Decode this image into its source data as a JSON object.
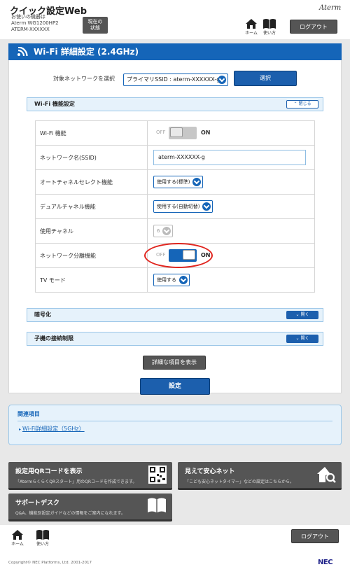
{
  "header": {
    "app_title": "クイック設定Web",
    "device_line1": "お使いの機器は",
    "device_line2": "Aterm WG1200HP2",
    "device_line3": "ATERM-XXXXXX",
    "status_button_line1": "現在の",
    "status_button_line2": "状態",
    "brand": "Aterm",
    "home_label": "ホーム",
    "help_label": "使い方",
    "logout_label": "ログアウト"
  },
  "page": {
    "title": "Wi-Fi 詳細設定 (2.4GHz)",
    "target_network_label": "対象ネットワークを選択",
    "target_network_value": "プライマリSSID : aterm-XXXXXX-g",
    "select_button": "選択"
  },
  "wifi_section": {
    "title": "Wi-Fi 機能設定",
    "collapse_label": "閉じる",
    "rows": [
      {
        "label": "Wi-Fi 機能",
        "type": "switch",
        "off": "OFF",
        "on": "ON",
        "state": "off"
      },
      {
        "label": "ネットワーク名(SSID)",
        "type": "text",
        "value": "aterm-XXXXXX-g"
      },
      {
        "label": "オートチャネルセレクト機能",
        "type": "select",
        "value": "使用する(標準)"
      },
      {
        "label": "デュアルチャネル機能",
        "type": "select",
        "value": "使用する(自動切替)"
      },
      {
        "label": "使用チャネル",
        "type": "select-disabled",
        "value": "6"
      },
      {
        "label": "ネットワーク分離機能",
        "type": "switch",
        "off": "OFF",
        "on": "ON",
        "state": "on"
      },
      {
        "label": "TV モード",
        "type": "select",
        "value": "使用する"
      }
    ]
  },
  "collapsed_sections": [
    {
      "title": "暗号化",
      "expand_label": "開く"
    },
    {
      "title": "子機の接続制限",
      "expand_label": "開く"
    }
  ],
  "actions": {
    "show_details": "詳細な項目を表示",
    "apply": "設定"
  },
  "related": {
    "title": "関連項目",
    "link": "Wi-Fi詳細設定（5GHz）"
  },
  "tiles": [
    {
      "title": "設定用QRコードを表示",
      "desc": "「AtermらくらくQRスタート」用のQRコードを作成できます。",
      "icon": "qr-code-icon"
    },
    {
      "title": "見えて安心ネット",
      "desc": "「こども安心ネットタイマー」などの設定はこちらから。",
      "icon": "home-search-icon"
    },
    {
      "title": "サポートデスク",
      "desc": "Q&A、機能別設定ガイドなどの情報をご案内になれます。",
      "icon": "book-icon"
    }
  ],
  "footer": {
    "home_label": "ホーム",
    "help_label": "使い方",
    "logout_label": "ログアウト",
    "copyright": "Copyright© NEC Platforms, Ltd. 2001-2017",
    "logo": "NEC"
  },
  "colors": {
    "primary": "#1565b8",
    "switch_off": "#c7c7c7",
    "highlight": "#e0231c"
  }
}
